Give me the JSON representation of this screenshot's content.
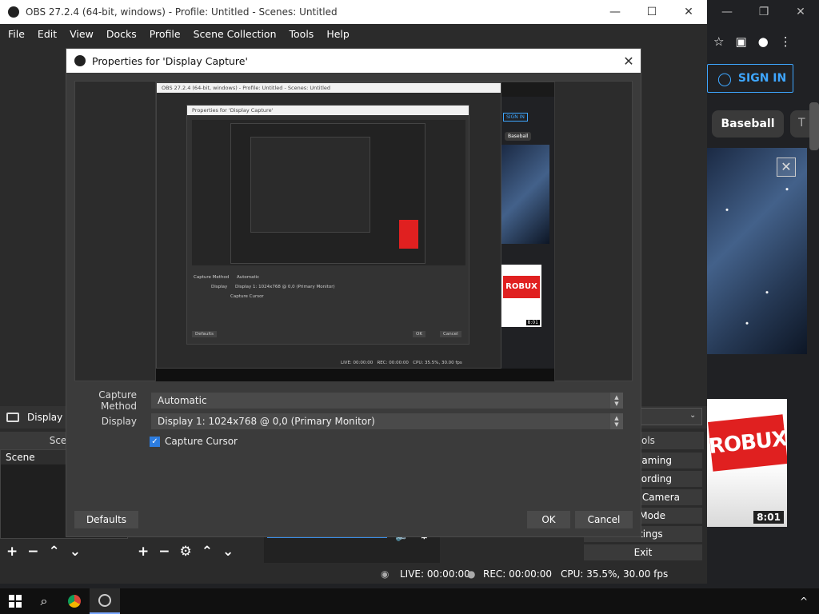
{
  "obs": {
    "title": "OBS 27.2.4 (64-bit, windows) - Profile: Untitled - Scenes: Untitled",
    "window_controls": [
      "—",
      "☐",
      "✕"
    ],
    "menu": [
      "File",
      "Edit",
      "View",
      "Docks",
      "Profile",
      "Scene Collection",
      "Tools",
      "Help"
    ],
    "source_bar_label": "Display Ca",
    "dock_scenes": "Scene",
    "dock_controls": "ols",
    "scene_item": "Scene",
    "controls": [
      "reaming",
      "ecording",
      "al Camera",
      " Mode",
      "Settings",
      "Exit"
    ],
    "status": {
      "live": "LIVE: 00:00:00",
      "rec": "REC: 00:00:00",
      "cpu": "CPU: 35.5%, 30.00 fps"
    }
  },
  "dialog": {
    "title": "Properties for 'Display Capture'",
    "close": "✕",
    "capture_method_label": "Capture Method",
    "capture_method_value": "Automatic",
    "display_label": "Display",
    "display_value": "Display 1: 1024x768 @ 0,0 (Primary Monitor)",
    "capture_cursor_label": "Capture Cursor",
    "capture_cursor_checked": true,
    "defaults_button": "Defaults",
    "ok_button": "OK",
    "cancel_button": "Cancel",
    "nested": {
      "obs_title": "OBS 27.2.4 (64-bit, windows) - Profile: Untitled - Scenes: Untitled",
      "dialog_title": "Properties for 'Display Capture'",
      "capture_method": "Capture Method",
      "capture_method_value": "Automatic",
      "display": "Display",
      "display_value": "Display 1: 1024x768 @ 0,0 (Primary Monitor)",
      "capture_cursor": "Capture Cursor",
      "defaults": "Defaults",
      "ok": "OK",
      "cancel": "Cancel",
      "sign_in": "SIGN IN",
      "baseball": "Baseball",
      "robux": "ROBUX",
      "duration": "8:01"
    }
  },
  "browser": {
    "window_controls": [
      "—",
      "❐",
      "✕"
    ],
    "sign_in": "SIGN IN",
    "chip": "Baseball",
    "chip_partial": "T",
    "thumb_text": "ROBUX",
    "thumb_duration": "8:01"
  },
  "taskbar": {
    "start": "start-button",
    "search": "search",
    "chrome": "chrome",
    "obs": "obs",
    "tray_chevron": "^"
  }
}
